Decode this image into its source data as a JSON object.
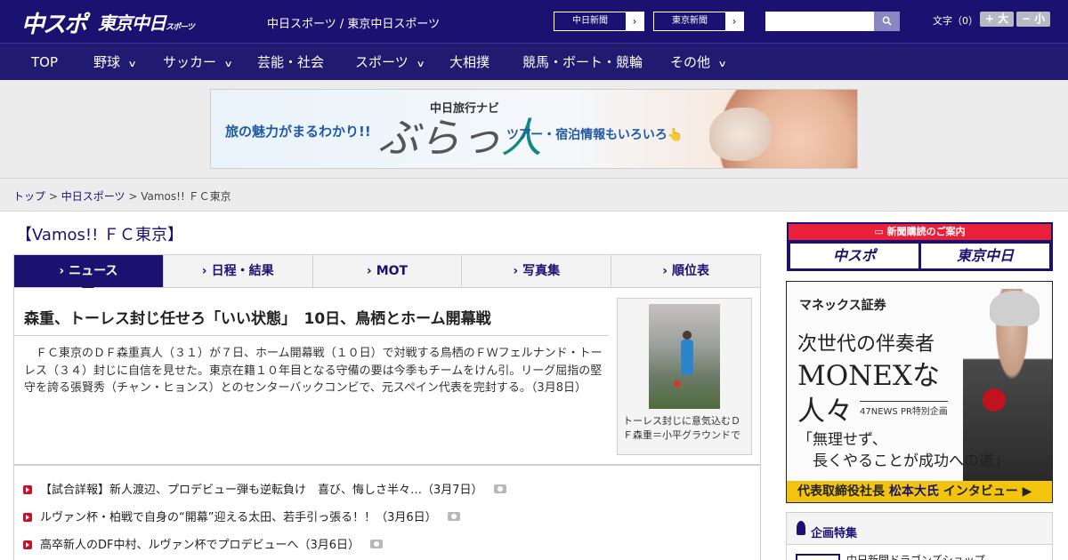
{
  "header": {
    "logo_primary": "中スポ",
    "logo_secondary": "東京中日",
    "logo_secondary_sub": "スポーツ",
    "site_title": "中日スポーツ / 東京中日スポーツ",
    "link1": "中日新聞",
    "link2": "東京新聞",
    "search_placeholder": "",
    "font_label": "文字（0）",
    "font_larger": "+ 大",
    "font_smaller": "− 小"
  },
  "nav": {
    "items": [
      {
        "label": "TOP"
      },
      {
        "label": "野球"
      },
      {
        "label": "サッカー"
      },
      {
        "label": "芸能・社会"
      },
      {
        "label": "スポーツ"
      },
      {
        "label": "大相撲"
      },
      {
        "label": "競馬・ボート・競輪"
      },
      {
        "label": "その他"
      }
    ]
  },
  "ad_banner": {
    "left_text": "旅の魅力がまるわかり!!",
    "brand": "中日旅行ナビ",
    "brand_big_1": "ぶらっ",
    "brand_big_2": "人",
    "right_text": "ツアー・宿泊情報もいろいろ👆"
  },
  "breadcrumb": {
    "home": "トップ",
    "section": "中日スポーツ",
    "current": "Vamos!! ＦＣ東京",
    "sep": ">"
  },
  "main": {
    "section_title": "【Vamos!! ＦＣ東京】",
    "tabs": [
      {
        "label": "ニュース"
      },
      {
        "label": "日程・結果"
      },
      {
        "label": "MOT"
      },
      {
        "label": "写真集"
      },
      {
        "label": "順位表"
      }
    ],
    "article": {
      "headline": "森重、トーレス封じ任せろ「いい状態」　10日、鳥栖とホーム開幕戦",
      "lead": "　ＦＣ東京のＤＦ森重真人（３１）が７日、ホーム開幕戦（１０日）で対戦する鳥栖のＦＷフェルナンド・トーレス（３４）封じに自信を見せた。東京在籍１０年目となる守備の要は今季もチームをけん引。リーグ屈指の堅守を誇る張賢秀（チャン・ヒョンス）とのセンターバックコンビで、元スペイン代表を完封する。（3月8日）",
      "caption": "トーレス封じに意気込むＤＦ森重＝小平グラウンドで"
    },
    "news_list": [
      {
        "text": "【試合詳報】新人渡辺、プロデビュー弾も逆転負け　喜び、悔しさ半々…（3月7日）"
      },
      {
        "text": "ルヴァン杯・柏戦で自身の“開幕”迎える太田、若手引っ張る！！（3月6日）"
      },
      {
        "text": "高卒新人のDF中村、ルヴァン杯でプロデビューへ（3月6日）"
      }
    ]
  },
  "sidebar": {
    "subscription_title": "新聞購読のご案内",
    "sub_btn_1": "中スポ",
    "sub_btn_2": "東京中日",
    "monex": {
      "logo": "マネックス証券",
      "line1": "次世代の伴奏者",
      "line2": "MONEXな",
      "line3": "人々",
      "pr": "47NEWS PR特別企画",
      "quote1": "「無理せず、",
      "quote2": "　長くやることが成功への道」",
      "bar_prefix": "代表取締役社長 ",
      "bar_name": "松本大氏",
      "bar_suffix": " インタビュー ▶"
    },
    "feature_title": "企画特集",
    "feature_item": "中日新聞ドラゴンズショップ"
  }
}
